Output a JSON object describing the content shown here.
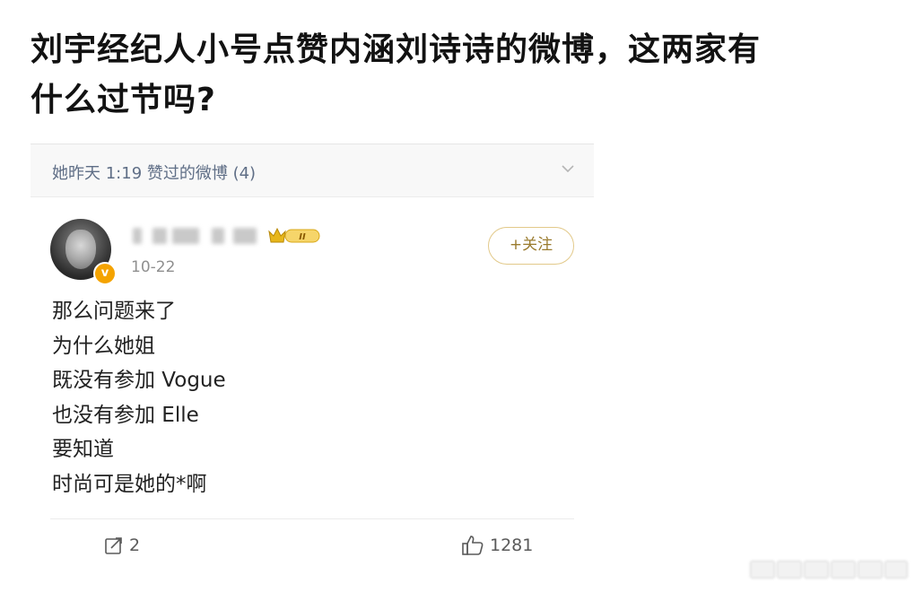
{
  "headline": {
    "line1": "刘宇经纪人小号点赞内涵刘诗诗的微博，这两家有",
    "line2": "什么过节吗?"
  },
  "liked_bar": {
    "text": "她昨天 1:19 赞过的微博 (4)",
    "icon": "chevron-down-icon"
  },
  "post": {
    "author_icon": "avatar",
    "verified_badge": "v",
    "crown_badge_text": "II",
    "date": "10-22",
    "follow_label": "+关注",
    "lines": [
      "那么问题来了",
      "为什么她姐",
      "既没有参加 Vogue",
      "也没有参加 Elle",
      "要知道",
      "时尚可是她的*啊"
    ],
    "actions": {
      "repost_icon": "share-icon",
      "repost_count": "2",
      "like_icon": "thumbs-up-icon",
      "like_count": "1281"
    }
  },
  "colors": {
    "link_blue": "#5f6e86",
    "follow_gold": "#9a7b2e",
    "verified_orange": "#f4a300"
  }
}
